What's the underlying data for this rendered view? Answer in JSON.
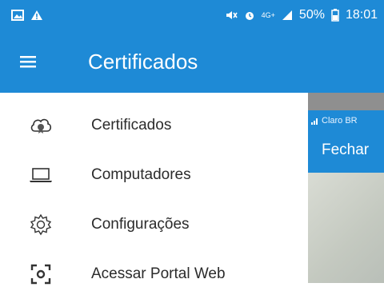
{
  "status_bar": {
    "battery_percent": "50%",
    "time": "18:01",
    "network": "4G+",
    "icons": [
      "image-icon",
      "warning-icon",
      "mute-icon",
      "alarm-icon",
      "signal-icon",
      "battery-icon"
    ]
  },
  "app_bar": {
    "title": "Certificados",
    "menu_icon": "hamburger-menu-icon"
  },
  "drawer": {
    "items": [
      {
        "label": "Certificados",
        "icon": "cloud-certificate-icon"
      },
      {
        "label": "Computadores",
        "icon": "laptop-icon"
      },
      {
        "label": "Configurações",
        "icon": "gear-icon"
      },
      {
        "label": "Acessar Portal Web",
        "icon": "scan-icon"
      }
    ]
  },
  "overlay_screen": {
    "carrier": "Claro BR",
    "close_label": "Fechar"
  },
  "colors": {
    "primary": "#1e8ad6",
    "text": "#2b2b2b",
    "background": "#ffffff"
  }
}
